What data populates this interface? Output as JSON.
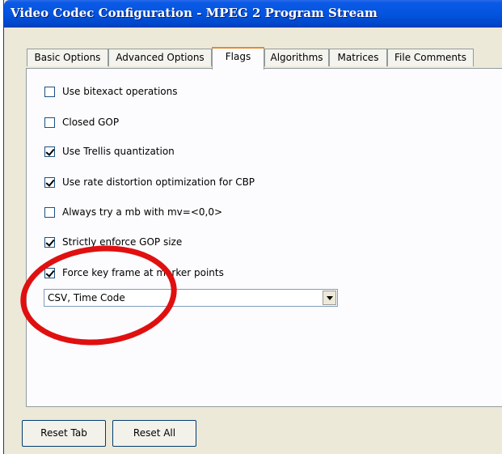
{
  "window": {
    "title": "Video Codec Configuration - MPEG 2 Program Stream"
  },
  "tabs": [
    {
      "label": "Basic Options",
      "active": false
    },
    {
      "label": "Advanced Options",
      "active": false
    },
    {
      "label": "Flags",
      "active": true
    },
    {
      "label": "Algorithms",
      "active": false
    },
    {
      "label": "Matrices",
      "active": false
    },
    {
      "label": "File Comments",
      "active": false
    }
  ],
  "flags": [
    {
      "label": "Use bitexact operations",
      "checked": false
    },
    {
      "label": "Closed GOP",
      "checked": false
    },
    {
      "label": "Use Trellis quantization",
      "checked": true
    },
    {
      "label": "Use rate distortion optimization for CBP",
      "checked": true
    },
    {
      "label": "Always try a mb with mv=<0,0>",
      "checked": false
    },
    {
      "label": "Strictly enforce GOP size",
      "checked": true
    },
    {
      "label": "Force key frame at marker points",
      "checked": true
    }
  ],
  "marker_format": {
    "selected": "CSV, Time Code"
  },
  "buttons": {
    "reset_tab": "Reset Tab",
    "reset_all": "Reset All"
  },
  "colors": {
    "annotation": "#e01010",
    "titlebar": "#0454e0",
    "active_tab_accent": "#e68b2c"
  }
}
